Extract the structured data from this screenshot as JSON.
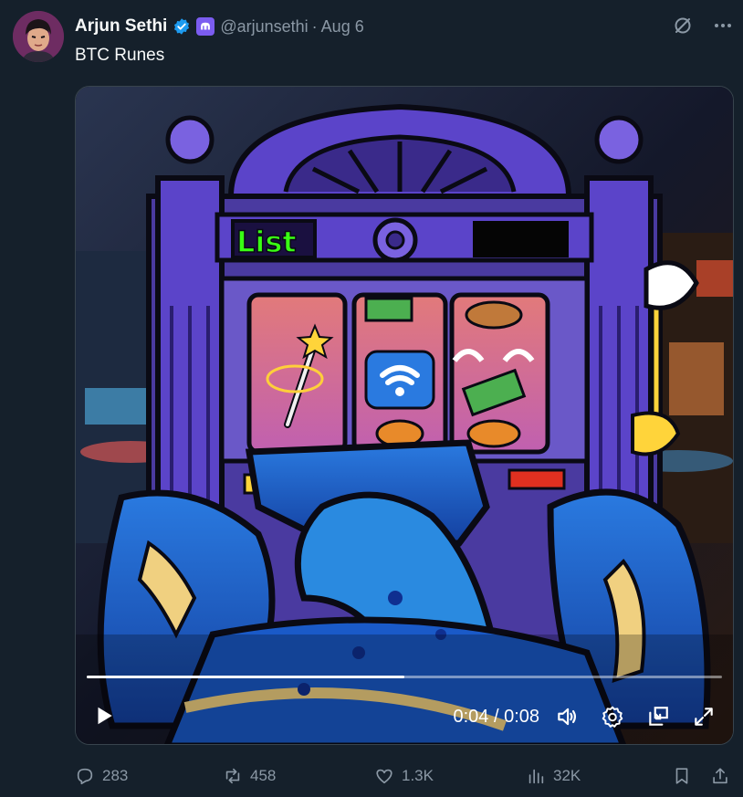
{
  "author": {
    "name": "Arjun Sethi",
    "handle": "@arjunsethi",
    "separator": "·",
    "date": "Aug 6",
    "icons": [
      "verified-badge-icon",
      "affiliate-badge-icon"
    ]
  },
  "tweet": {
    "text": "BTC Runes"
  },
  "top_actions": {
    "icons": [
      "grok-icon",
      "more-icon"
    ]
  },
  "media": {
    "type": "video",
    "sign_text": "List",
    "time_display": "0:04 / 0:08",
    "progress": 0.5,
    "controls": [
      "play-icon",
      "volume-icon",
      "settings-icon",
      "picture-in-picture-icon",
      "fullscreen-icon"
    ]
  },
  "engagement": {
    "replies": "283",
    "reposts": "458",
    "likes": "1.3K",
    "views": "32K",
    "icons": [
      "reply-icon",
      "repost-icon",
      "like-icon",
      "views-icon",
      "bookmark-icon",
      "share-icon"
    ]
  },
  "colors": {
    "background": "#15202b",
    "text": "#f7f9f9",
    "secondary_text": "#8b98a5",
    "verified": "#1d9bf0",
    "affiliate": "#7b5cf0",
    "machine_purple": "#5b44c9",
    "neon_green": "#39ff14"
  }
}
